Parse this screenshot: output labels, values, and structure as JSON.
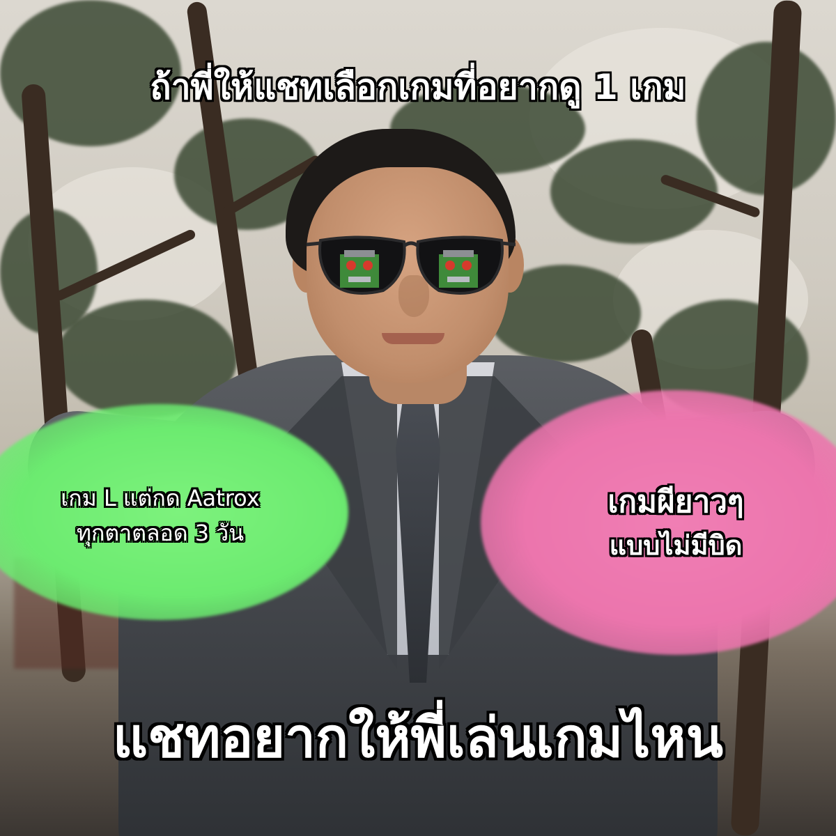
{
  "meme": {
    "top_caption": "ถ้าพี่ให้แชทเลือกเกมที่อยากดู 1 เกม",
    "green_option": {
      "line1": "เกม L แต่กด Aatrox",
      "line2": "ทุกตาตลอด 3 วัน",
      "color": "#6ceb70"
    },
    "pink_option": {
      "line1": "เกมผียาวๆ",
      "line2": "แบบไม่มีบิด",
      "color": "#ec75ad"
    },
    "bottom_caption": "แชทอยากให้พี่เล่นเกมไหน"
  }
}
